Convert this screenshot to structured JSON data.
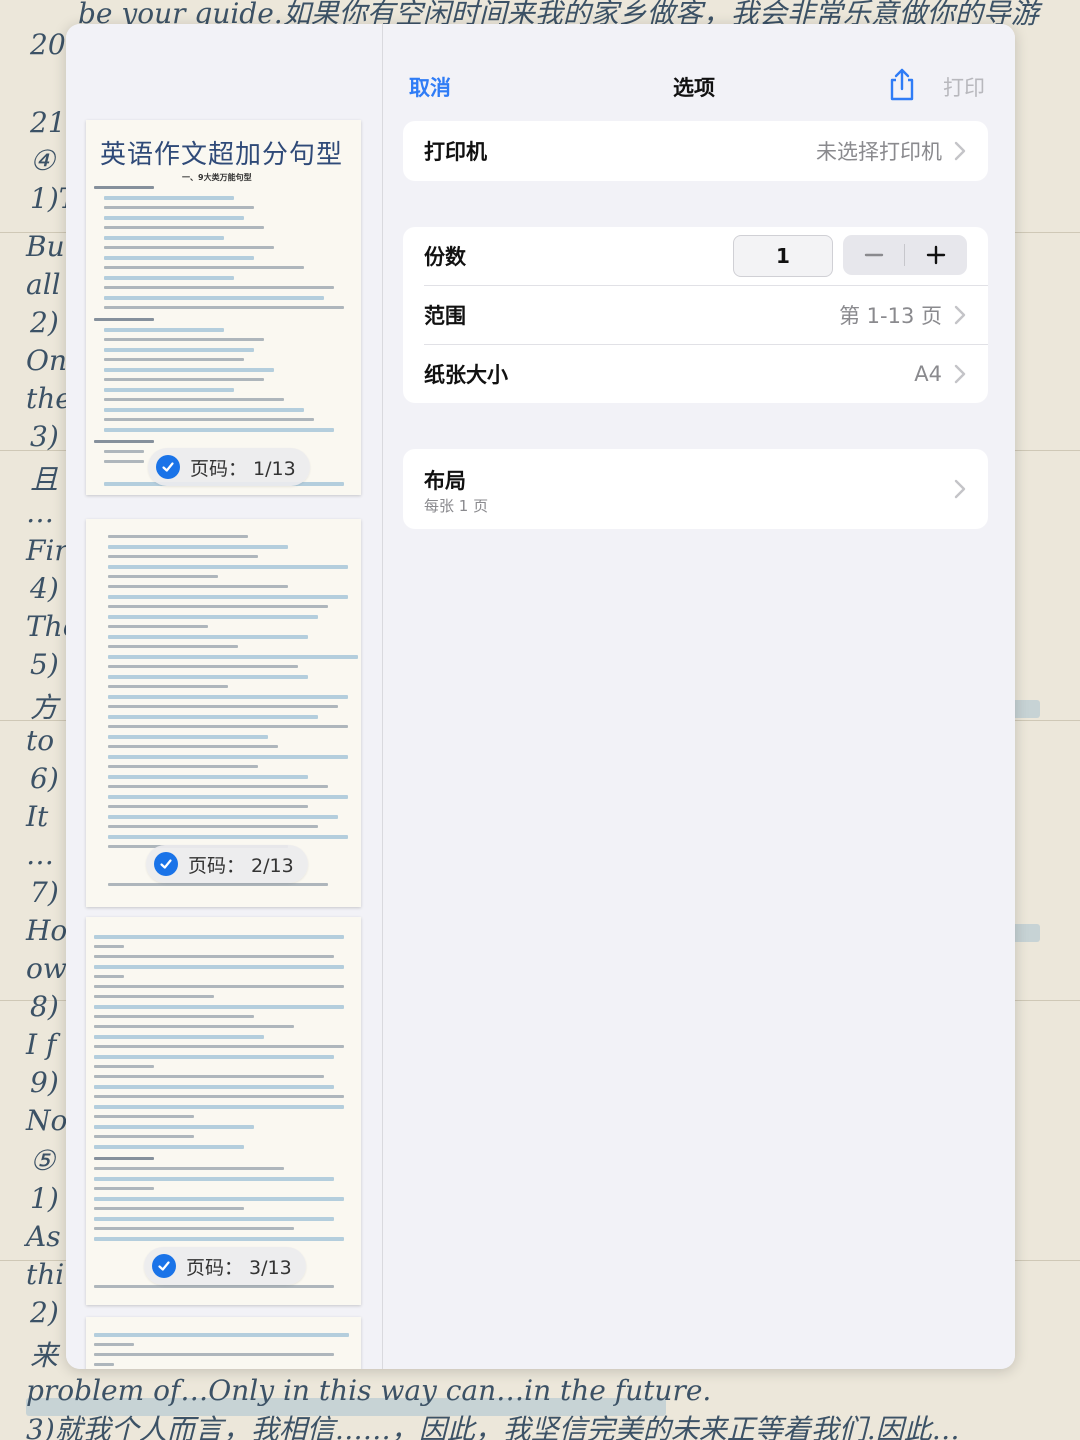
{
  "background": {
    "lines": [
      "be your guide.如果你有空闲时间来我的家乡做客，我会非常乐意做你的导游",
      "20",
      "21.",
      "④",
      "1)T",
      "But",
      "all",
      "2)",
      "On",
      "the",
      "3)",
      "且",
      "…",
      "Fir",
      "4)",
      "The",
      "5)",
      "方",
      "to",
      "6)",
      "It",
      "…",
      "7)",
      "Ho",
      "ow",
      "8)",
      "I f",
      "9)",
      "No",
      "⑤",
      "1)",
      "As",
      "thi",
      "2)",
      "来",
      "problem of…Only in this way can…in the future.",
      "3)就我个人而言，我相信……，因此，我坚信完美的未来正等着我们.因此…"
    ]
  },
  "dialog": {
    "cancel_label": "取消",
    "title": "选项",
    "share_icon": "share-icon",
    "print_label": "打印",
    "accent_color": "#2f7cf6",
    "disabled_color": "#b8b8bd"
  },
  "printer": {
    "label": "打印机",
    "value": "未选择打印机"
  },
  "copies": {
    "label": "份数",
    "value": "1",
    "minus": "−",
    "plus": "+"
  },
  "range": {
    "label": "范围",
    "value": "第 1-13 页"
  },
  "paper": {
    "label": "纸张大小",
    "value": "A4"
  },
  "layout": {
    "label": "布局",
    "subtitle": "每张 1 页"
  },
  "pages": [
    {
      "title": "英语作文超加分句型",
      "subtitle": "一、9大类万能句型",
      "badge": "页码：  1/13",
      "selected": true
    },
    {
      "badge": "页码：  2/13",
      "selected": true
    },
    {
      "badge": "页码：  3/13",
      "selected": true
    },
    {
      "selected": false
    }
  ]
}
